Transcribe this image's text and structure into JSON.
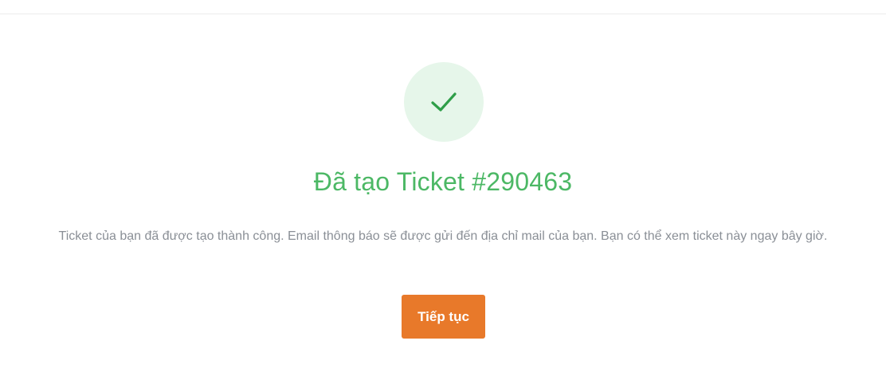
{
  "success": {
    "icon": "checkmark-icon",
    "title": "Đã tạo Ticket #290463",
    "message": "Ticket của bạn đã được tạo thành công. Email thông báo sẽ được gửi đến địa chỉ mail của bạn. Bạn có thể xem ticket này ngay bây giờ.",
    "continue_label": "Tiếp tục"
  },
  "colors": {
    "success_green": "#4cb865",
    "check_green": "#2e9e48",
    "circle_bg": "#e6f6ea",
    "message_text": "#8a8f96",
    "button_orange": "#e8792a",
    "divider": "#ececec"
  }
}
